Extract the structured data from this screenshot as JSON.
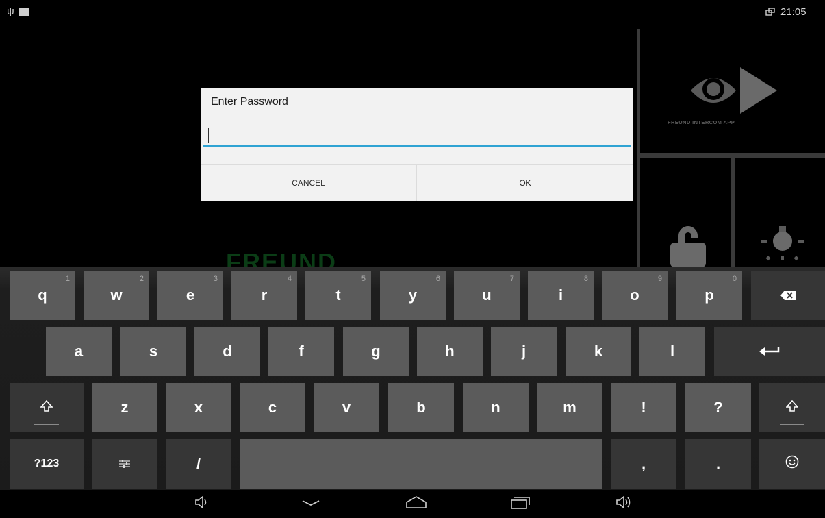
{
  "status_bar": {
    "time": "21:05",
    "icons": [
      "usb-icon",
      "sd-card-icon",
      "screen-connection-icon"
    ]
  },
  "app": {
    "logo_caption": "FREUND INTERCOM APP",
    "brand_watermark": "FREUND",
    "tiles": [
      "eye-logo-icon",
      "unlock-icon",
      "light-icon"
    ]
  },
  "dialog": {
    "title": "Enter Password",
    "password_value": "",
    "cancel_label": "CANCEL",
    "ok_label": "OK",
    "accent_color": "#2fa3d3"
  },
  "keyboard": {
    "row1": [
      {
        "label": "q",
        "hint": "1"
      },
      {
        "label": "w",
        "hint": "2"
      },
      {
        "label": "e",
        "hint": "3"
      },
      {
        "label": "r",
        "hint": "4"
      },
      {
        "label": "t",
        "hint": "5"
      },
      {
        "label": "y",
        "hint": "6"
      },
      {
        "label": "u",
        "hint": "7"
      },
      {
        "label": "i",
        "hint": "8"
      },
      {
        "label": "o",
        "hint": "9"
      },
      {
        "label": "p",
        "hint": "0"
      }
    ],
    "row2": [
      "a",
      "s",
      "d",
      "f",
      "g",
      "h",
      "j",
      "k",
      "l"
    ],
    "row3": [
      "z",
      "x",
      "c",
      "v",
      "b",
      "n",
      "m",
      "!",
      "?"
    ],
    "row4": {
      "symbols": "?123",
      "slash": "/",
      "comma": ",",
      "period": "."
    },
    "special_icons": [
      "backspace-icon",
      "enter-icon",
      "shift-icon",
      "settings-icon",
      "emoji-icon"
    ]
  },
  "nav_bar": {
    "icons": [
      "volume-down-icon",
      "hide-keyboard-icon",
      "home-icon",
      "recents-icon",
      "volume-up-icon"
    ]
  }
}
